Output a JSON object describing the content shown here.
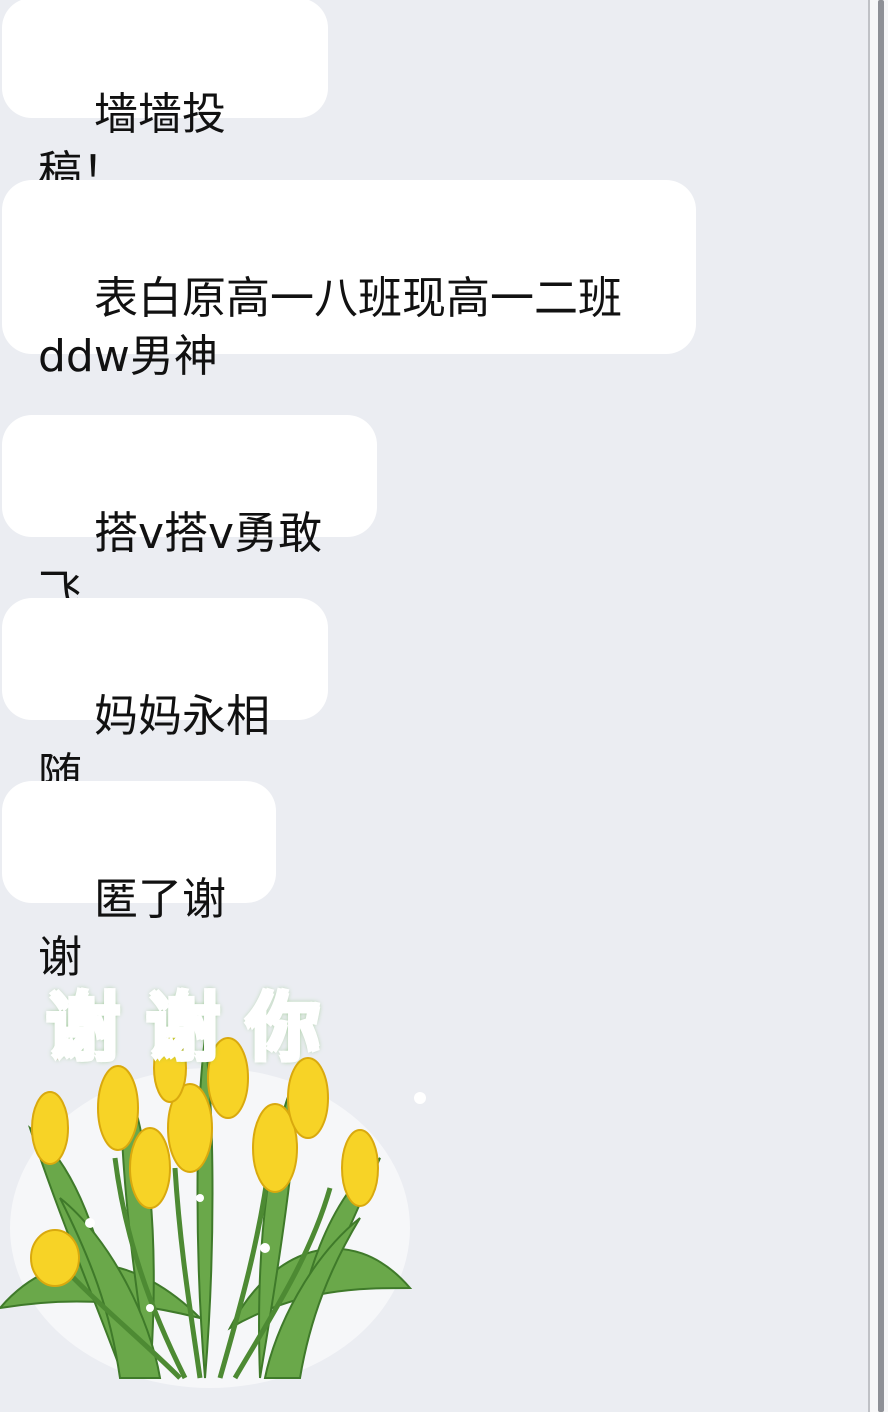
{
  "messages": [
    {
      "text": "墙墙投稿！"
    },
    {
      "text": "表白原高一八班现高一二班\nddw男神"
    },
    {
      "text": "搭v搭v勇敢飞"
    },
    {
      "text": "妈妈永相随"
    },
    {
      "text": "匿了谢谢"
    }
  ],
  "sticker": {
    "caption": "谢谢你",
    "icon": "yellow-tulip-bouquet"
  },
  "colors": {
    "background": "#ebedf2",
    "bubble": "#ffffff",
    "text": "#111111",
    "tulip_yellow": "#f5d22a",
    "leaf_green": "#5e9a3c"
  }
}
